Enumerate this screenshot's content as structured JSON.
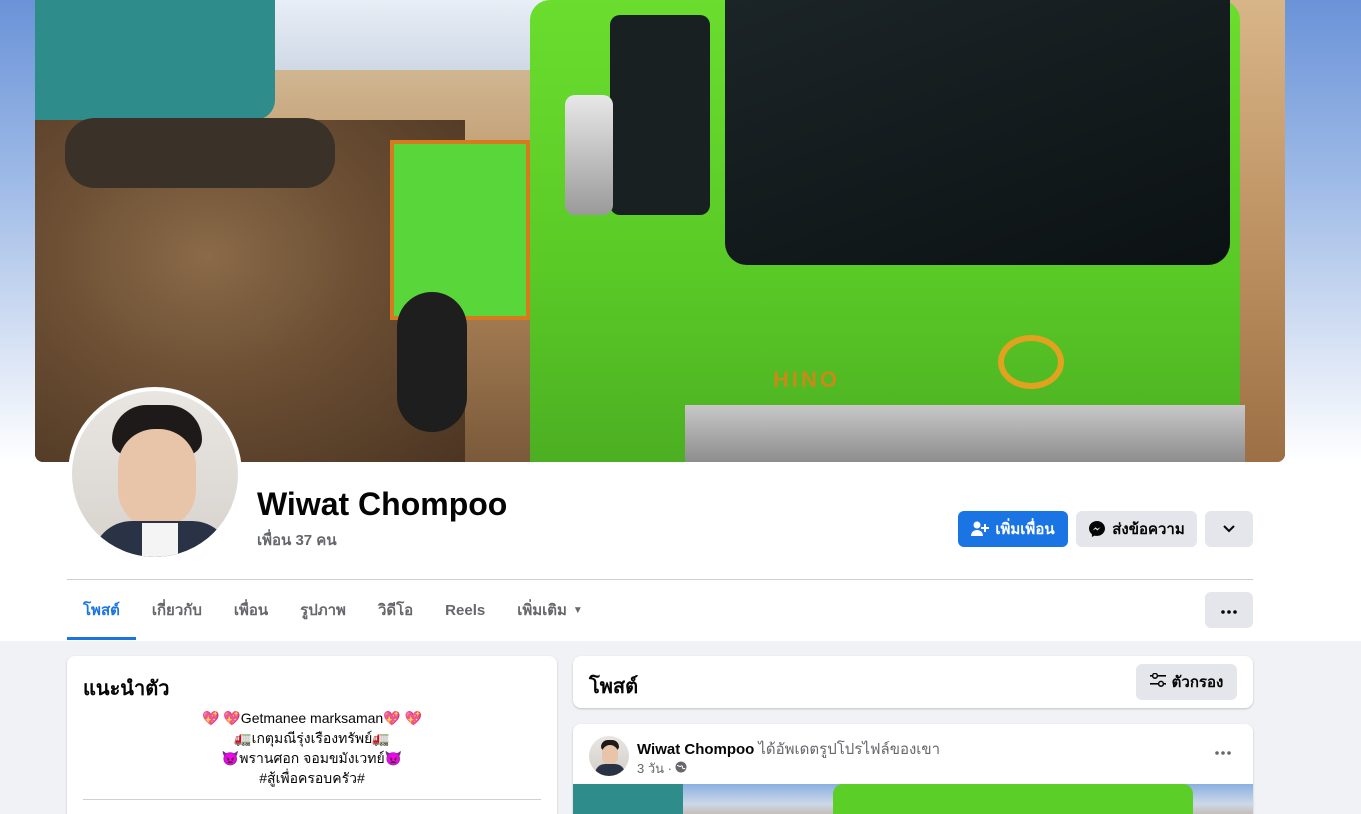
{
  "profile": {
    "name": "Wiwat Chompoo",
    "friend_count": "เพื่อน 37 คน",
    "cover_brand": "HINO"
  },
  "actions": {
    "add_friend": "เพิ่มเพื่อน",
    "message": "ส่งข้อความ"
  },
  "tabs": [
    {
      "label": "โพสต์",
      "active": true
    },
    {
      "label": "เกี่ยวกับ",
      "active": false
    },
    {
      "label": "เพื่อน",
      "active": false
    },
    {
      "label": "รูปภาพ",
      "active": false
    },
    {
      "label": "วิดีโอ",
      "active": false
    },
    {
      "label": "Reels",
      "active": false
    },
    {
      "label": "เพิ่มเติม",
      "active": false
    }
  ],
  "intro": {
    "title": "แนะนำตัว",
    "bio_lines": [
      "💖 💖Getmanee marksaman💖 💖",
      "🚛เกตุมณีรุ่งเรืองทรัพย์🚛",
      "👿พรานศอก จอมขมังเวทย์👿",
      "#สู้เพื่อครอบครัว#"
    ]
  },
  "posts_section": {
    "title": "โพสต์",
    "filter_label": "ตัวกรอง"
  },
  "post": {
    "author": "Wiwat Chompoo",
    "action_text": "ได้อัพเดตรูปโปรไฟล์ของเขา",
    "time": "3 วัน ·"
  },
  "colors": {
    "accent": "#1b74e4",
    "page_bg": "#f0f2f5",
    "button_gray": "#e4e6eb",
    "secondary_text": "#65676b"
  },
  "icons": {
    "add_friend": "person-plus-icon",
    "message": "messenger-icon",
    "dropdown": "chevron-down-icon",
    "more": "more-horizontal-icon",
    "filter": "filter-sliders-icon",
    "privacy": "globe-icon"
  }
}
